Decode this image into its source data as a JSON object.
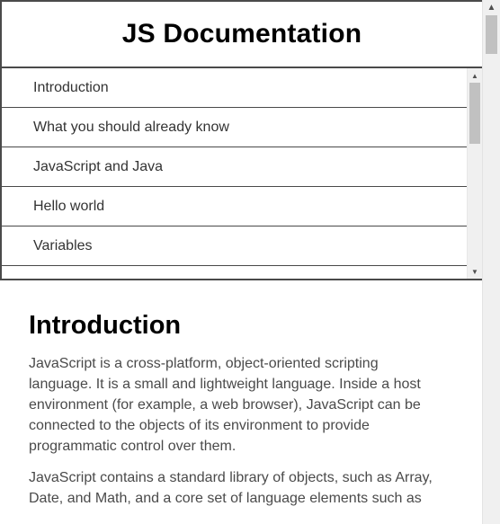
{
  "nav": {
    "title": "JS Documentation",
    "items": [
      {
        "label": "Introduction"
      },
      {
        "label": "What you should already know"
      },
      {
        "label": "JavaScript and Java"
      },
      {
        "label": "Hello world"
      },
      {
        "label": "Variables"
      }
    ]
  },
  "main": {
    "section_title": "Introduction",
    "paragraph1": [
      "JavaScript is a cross-platform, object-oriented scripting",
      "language. It is a small and lightweight language. Inside a host",
      "environment (for example, a web browser), JavaScript can be",
      "connected to the objects of its environment to provide",
      "programmatic control over them."
    ],
    "paragraph2": [
      "JavaScript contains a standard library of objects, such as Array,",
      "Date, and Math, and a core set of language elements such as"
    ]
  }
}
